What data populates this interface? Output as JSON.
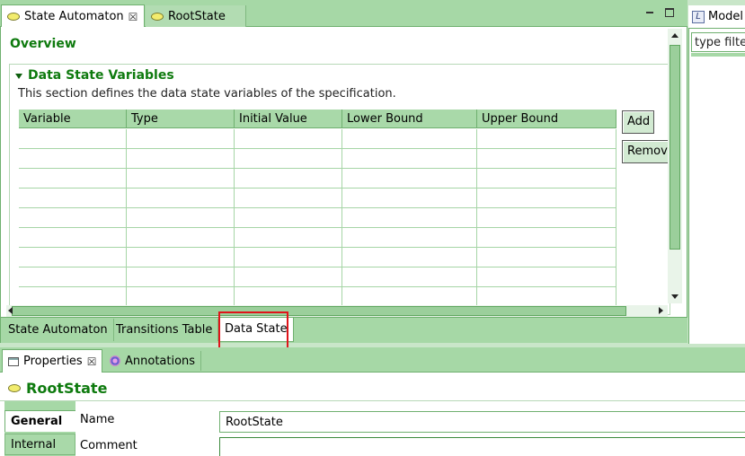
{
  "editor": {
    "tabs": [
      {
        "label": "State Automaton",
        "icon": "state-oval-icon",
        "closable": true,
        "active": true
      },
      {
        "label": "RootState",
        "icon": "state-oval-icon",
        "closable": false,
        "active": false
      }
    ],
    "overview_title": "Overview",
    "section": {
      "title": "Data State Variables",
      "description": "This section defines the data state variables of the specification.",
      "table": {
        "columns": [
          "Variable",
          "Type",
          "Initial Value",
          "Lower Bound",
          "Upper Bound"
        ],
        "rows": []
      },
      "buttons": {
        "add": "Add",
        "remove": "Remove"
      }
    },
    "page_tabs": [
      "State Automaton",
      "Transitions Table",
      "Data State"
    ],
    "selected_page_tab": "Data State"
  },
  "outline": {
    "title": "Model",
    "filter_text": "type filter text"
  },
  "properties": {
    "tabs": [
      {
        "label": "Properties",
        "icon": "properties-icon",
        "closable": true
      },
      {
        "label": "Annotations",
        "icon": "annotations-icon",
        "closable": false
      }
    ],
    "title": "RootState",
    "side_tabs": [
      "General",
      "Internal"
    ],
    "fields": {
      "name_label": "Name",
      "name_value": "RootState",
      "comment_label": "Comment",
      "comment_value": ""
    }
  },
  "colors": {
    "accent_green": "#0e7a0e",
    "tab_green": "#a6d8a6",
    "highlight_red": "#e0141a"
  }
}
